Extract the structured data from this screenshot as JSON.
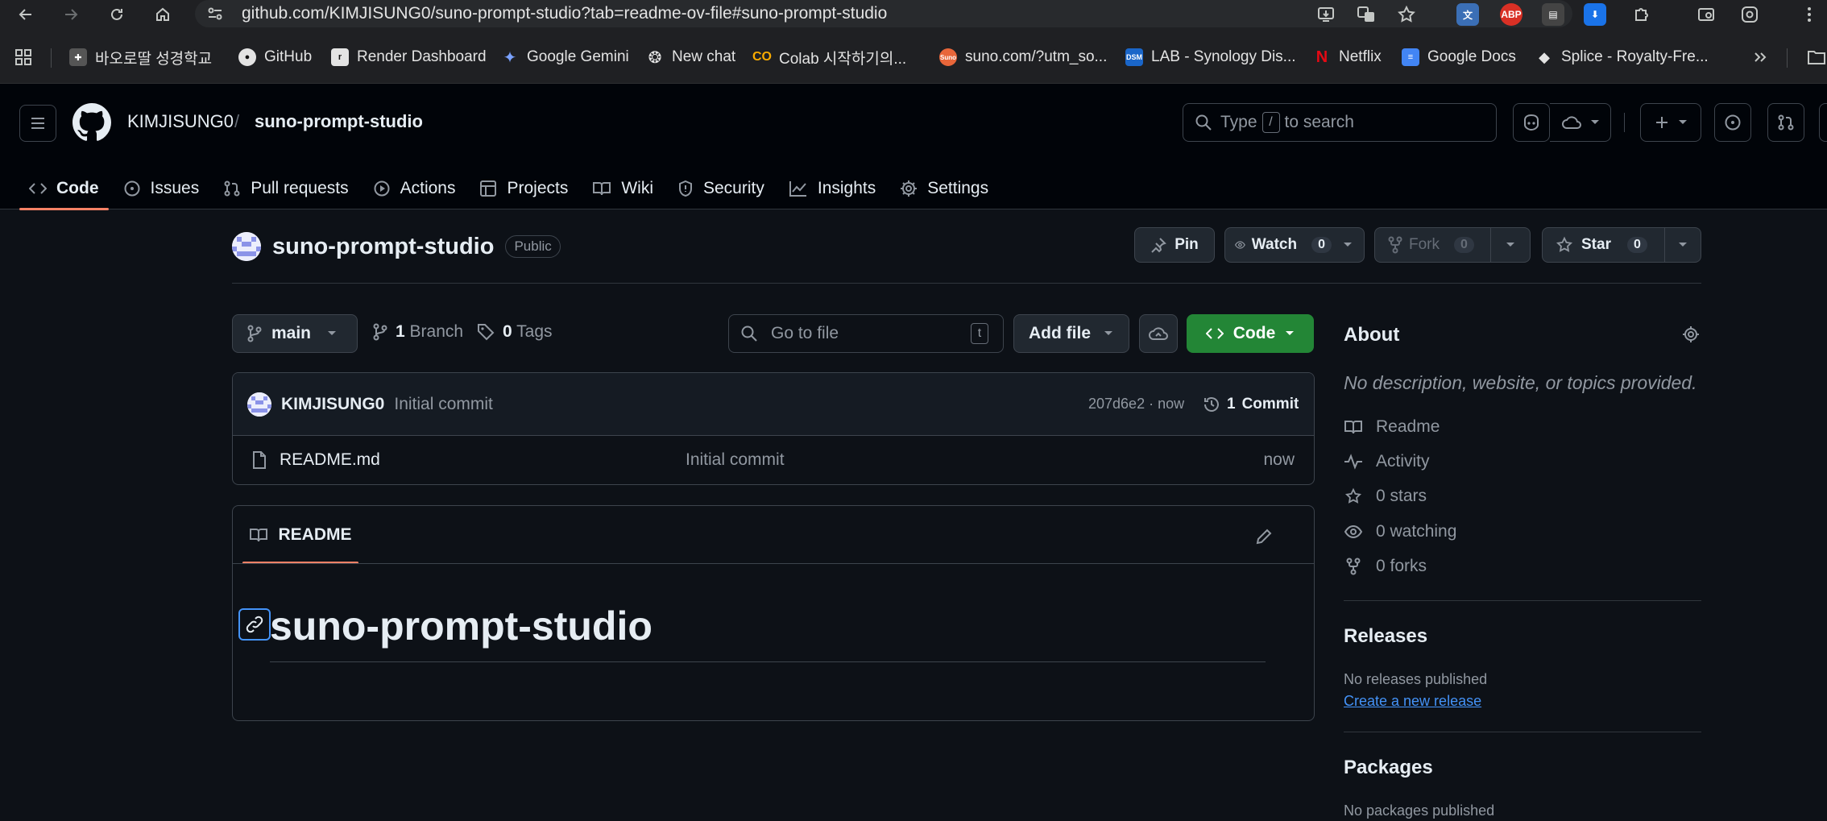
{
  "browser": {
    "url": "github.com/KIMJISUNG0/suno-prompt-studio?tab=readme-ov-file#suno-prompt-studio",
    "bookmarks": [
      "바오로딸 성경학교",
      "GitHub",
      "Render Dashboard",
      "Google Gemini",
      "New chat",
      "Colab 시작하기의...",
      "suno.com/?utm_so...",
      "LAB - Synology Dis...",
      "Netflix",
      "Google Docs",
      "Splice - Royalty-Fre..."
    ]
  },
  "header": {
    "owner": "KIMJISUNG0",
    "separator": "/",
    "repo": "suno-prompt-studio",
    "search_pre": "Type",
    "search_key": "/",
    "search_post": "to search",
    "tabs": [
      "Code",
      "Issues",
      "Pull requests",
      "Actions",
      "Projects",
      "Wiki",
      "Security",
      "Insights",
      "Settings"
    ]
  },
  "repo": {
    "name": "suno-prompt-studio",
    "visibility": "Public",
    "pin_label": "Pin",
    "watch_label": "Watch",
    "watch_count": "0",
    "fork_label": "Fork",
    "fork_count": "0",
    "star_label": "Star",
    "star_count": "0"
  },
  "file_nav": {
    "branch": "main",
    "branch_count": "1",
    "branch_label": "Branch",
    "tag_count": "0",
    "tag_label": "Tags",
    "goto_placeholder": "Go to file",
    "goto_key": "t",
    "add_file": "Add file",
    "code_button": "Code"
  },
  "latest_commit": {
    "author": "KIMJISUNG0",
    "message": "Initial commit",
    "sha_time": "207d6e2 · now",
    "commits_count": "1",
    "commits_label": "Commit"
  },
  "files": [
    {
      "name": "README.md",
      "message": "Initial commit",
      "time": "now"
    }
  ],
  "readme": {
    "tab_label": "README",
    "heading": "suno-prompt-studio"
  },
  "about": {
    "title": "About",
    "description": "No description, website, or topics provided.",
    "items": [
      "Readme",
      "Activity",
      "0 stars",
      "0 watching",
      "0 forks"
    ],
    "releases_title": "Releases",
    "releases_text": "No releases published",
    "releases_link": "Create a new release",
    "packages_title": "Packages",
    "packages_text": "No packages published"
  },
  "colors": {
    "bg": "#0d1117",
    "header_bg": "#010409",
    "accent_tab": "#f78166",
    "green": "#238636",
    "link": "#4493f8"
  }
}
